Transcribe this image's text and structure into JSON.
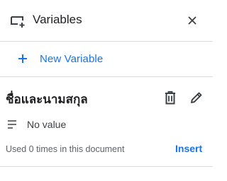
{
  "header": {
    "title": "Variables",
    "icon": "add-variable-icon",
    "close_icon": "close-icon"
  },
  "actions": {
    "new_variable_label": "New Variable",
    "new_variable_icon": "plus-icon"
  },
  "variable": {
    "name": "ชื่อและนามสกุล",
    "value": "No value",
    "usage": "Used 0 times in this document",
    "insert_label": "Insert",
    "delete_icon": "trash-icon",
    "edit_icon": "pencil-icon"
  },
  "colors": {
    "accent": "#1a73e8",
    "text": "#202124",
    "muted": "#5f6368",
    "divider": "#dadce0"
  }
}
